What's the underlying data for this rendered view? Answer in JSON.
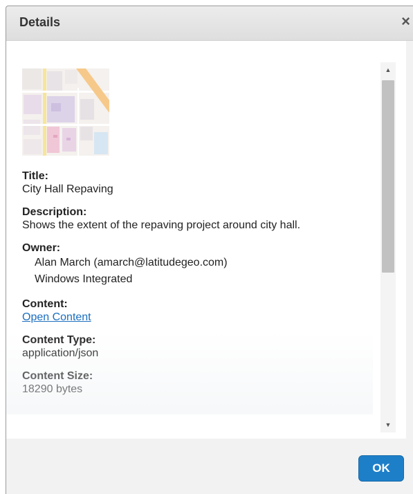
{
  "dialog": {
    "title": "Details",
    "close_label": "×",
    "ok_label": "OK"
  },
  "thumbnail": {
    "icon": "map-thumbnail"
  },
  "fields": {
    "title_label": "Title:",
    "title_value": "City Hall Repaving",
    "description_label": "Description:",
    "description_value": "Shows the extent of the repaving project around city hall.",
    "owner_label": "Owner:",
    "owner_name": "Alan March (amarch@latitudegeo.com)",
    "owner_auth": "Windows Integrated",
    "content_label": "Content:",
    "content_link": "Open Content",
    "content_type_label": "Content Type:",
    "content_type_value": "application/json",
    "content_size_label": "Content Size:",
    "content_size_value": "18290 bytes"
  },
  "scrollbar": {
    "up_icon": "▲",
    "down_icon": "▼",
    "position": 0.0
  },
  "colors": {
    "accent": "#1e7fc9",
    "link": "#1a6ebf"
  }
}
